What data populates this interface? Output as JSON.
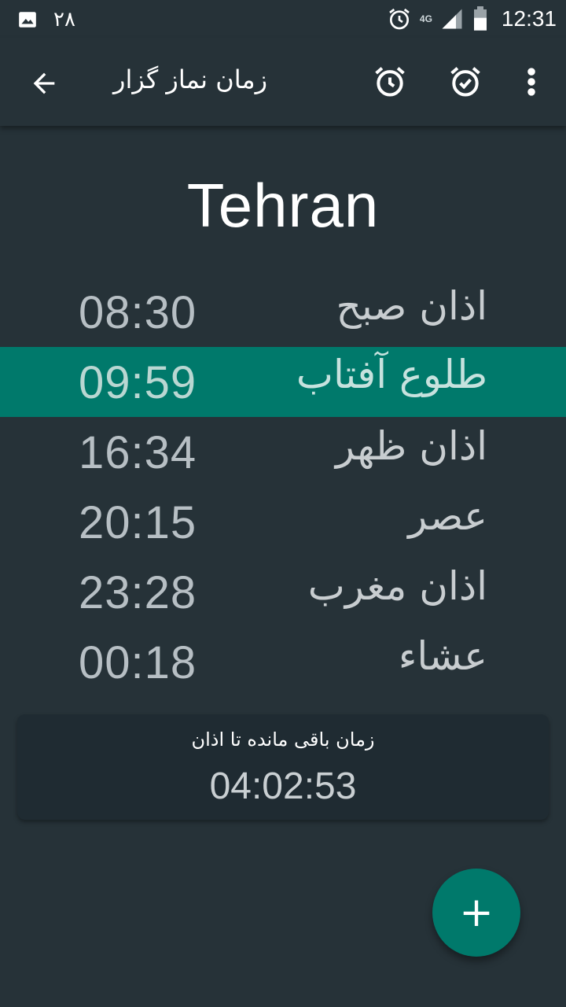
{
  "status_bar": {
    "notification_count": "۲۸",
    "network": "4G",
    "clock": "12:31",
    "icons": [
      "image-icon",
      "alarm-icon",
      "signal-icon",
      "battery-icon"
    ]
  },
  "app_bar": {
    "title": "زمان نماز گزار",
    "icons": [
      "back-arrow-icon",
      "alarm-clock-icon",
      "alarm-check-icon",
      "more-vert-icon"
    ]
  },
  "city": "Tehran",
  "prayer_times": [
    {
      "name": "اذان صبح",
      "time": "08:30",
      "highlighted": false
    },
    {
      "name": "طلوع آفتاب",
      "time": "09:59",
      "highlighted": true
    },
    {
      "name": "اذان ظهر",
      "time": "16:34",
      "highlighted": false
    },
    {
      "name": "عصر",
      "time": "20:15",
      "highlighted": false
    },
    {
      "name": "اذان مغرب",
      "time": "23:28",
      "highlighted": false
    },
    {
      "name": "عشاء",
      "time": "00:18",
      "highlighted": false
    }
  ],
  "countdown": {
    "label": "زمان باقی مانده تا اذان",
    "value": "04:02:53"
  },
  "fab": {
    "symbol": "+",
    "icon": "plus-icon"
  },
  "colors": {
    "background": "#263238",
    "accent": "#00796b",
    "card": "#1f2b32"
  }
}
